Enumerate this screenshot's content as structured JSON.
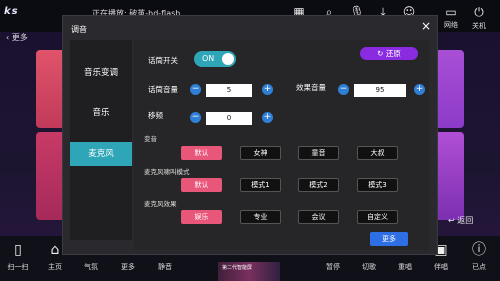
{
  "topbar": {
    "logo": "ks",
    "now_playing": "正在播放: 破茧-hd-flash",
    "network_label": "网络",
    "power_label": "关机"
  },
  "background": {
    "back_label": "更多",
    "return_label": "返回"
  },
  "bottombar": {
    "items": [
      {
        "label": "扫一扫"
      },
      {
        "label": "主页"
      },
      {
        "label": "气氛"
      },
      {
        "label": "更多"
      },
      {
        "label": "静音"
      },
      {
        "label": "暂停"
      },
      {
        "label": "切歌"
      },
      {
        "label": "重唱"
      },
      {
        "label": "伴唱"
      },
      {
        "label": "已点"
      }
    ],
    "thumb_text": "第二代智能屏"
  },
  "dialog": {
    "title": "调音",
    "close": "×",
    "tabs": [
      {
        "label": "音乐变调"
      },
      {
        "label": "音乐"
      },
      {
        "label": "麦克风"
      }
    ],
    "active_tab": "麦克风",
    "mic_switch_label": "话筒开关",
    "mic_switch_value": "ON",
    "reset_label": "还原",
    "mic_volume_label": "话筒音量",
    "mic_volume_value": "5",
    "effect_volume_label": "效果音量",
    "effect_volume_value": "95",
    "shift_label": "移频",
    "shift_value": "0",
    "voice_change": {
      "title": "变音",
      "options": [
        "默认",
        "女神",
        "童音",
        "大叔"
      ],
      "selected": "默认"
    },
    "mic_shield": {
      "title": "麦克风啸叫模式",
      "options": [
        "默认",
        "模式1",
        "模式2",
        "模式3"
      ],
      "selected": "默认"
    },
    "mic_effect": {
      "title": "麦克风效果",
      "options": [
        "娱乐",
        "专业",
        "会议",
        "自定义"
      ],
      "selected": "娱乐"
    },
    "more_label": "更多"
  },
  "colors": {
    "accent_teal": "#2fa6b8",
    "selected_pink": "#e8567a",
    "reset_purple": "#8a2be2",
    "step_blue": "#2f7fd6"
  }
}
